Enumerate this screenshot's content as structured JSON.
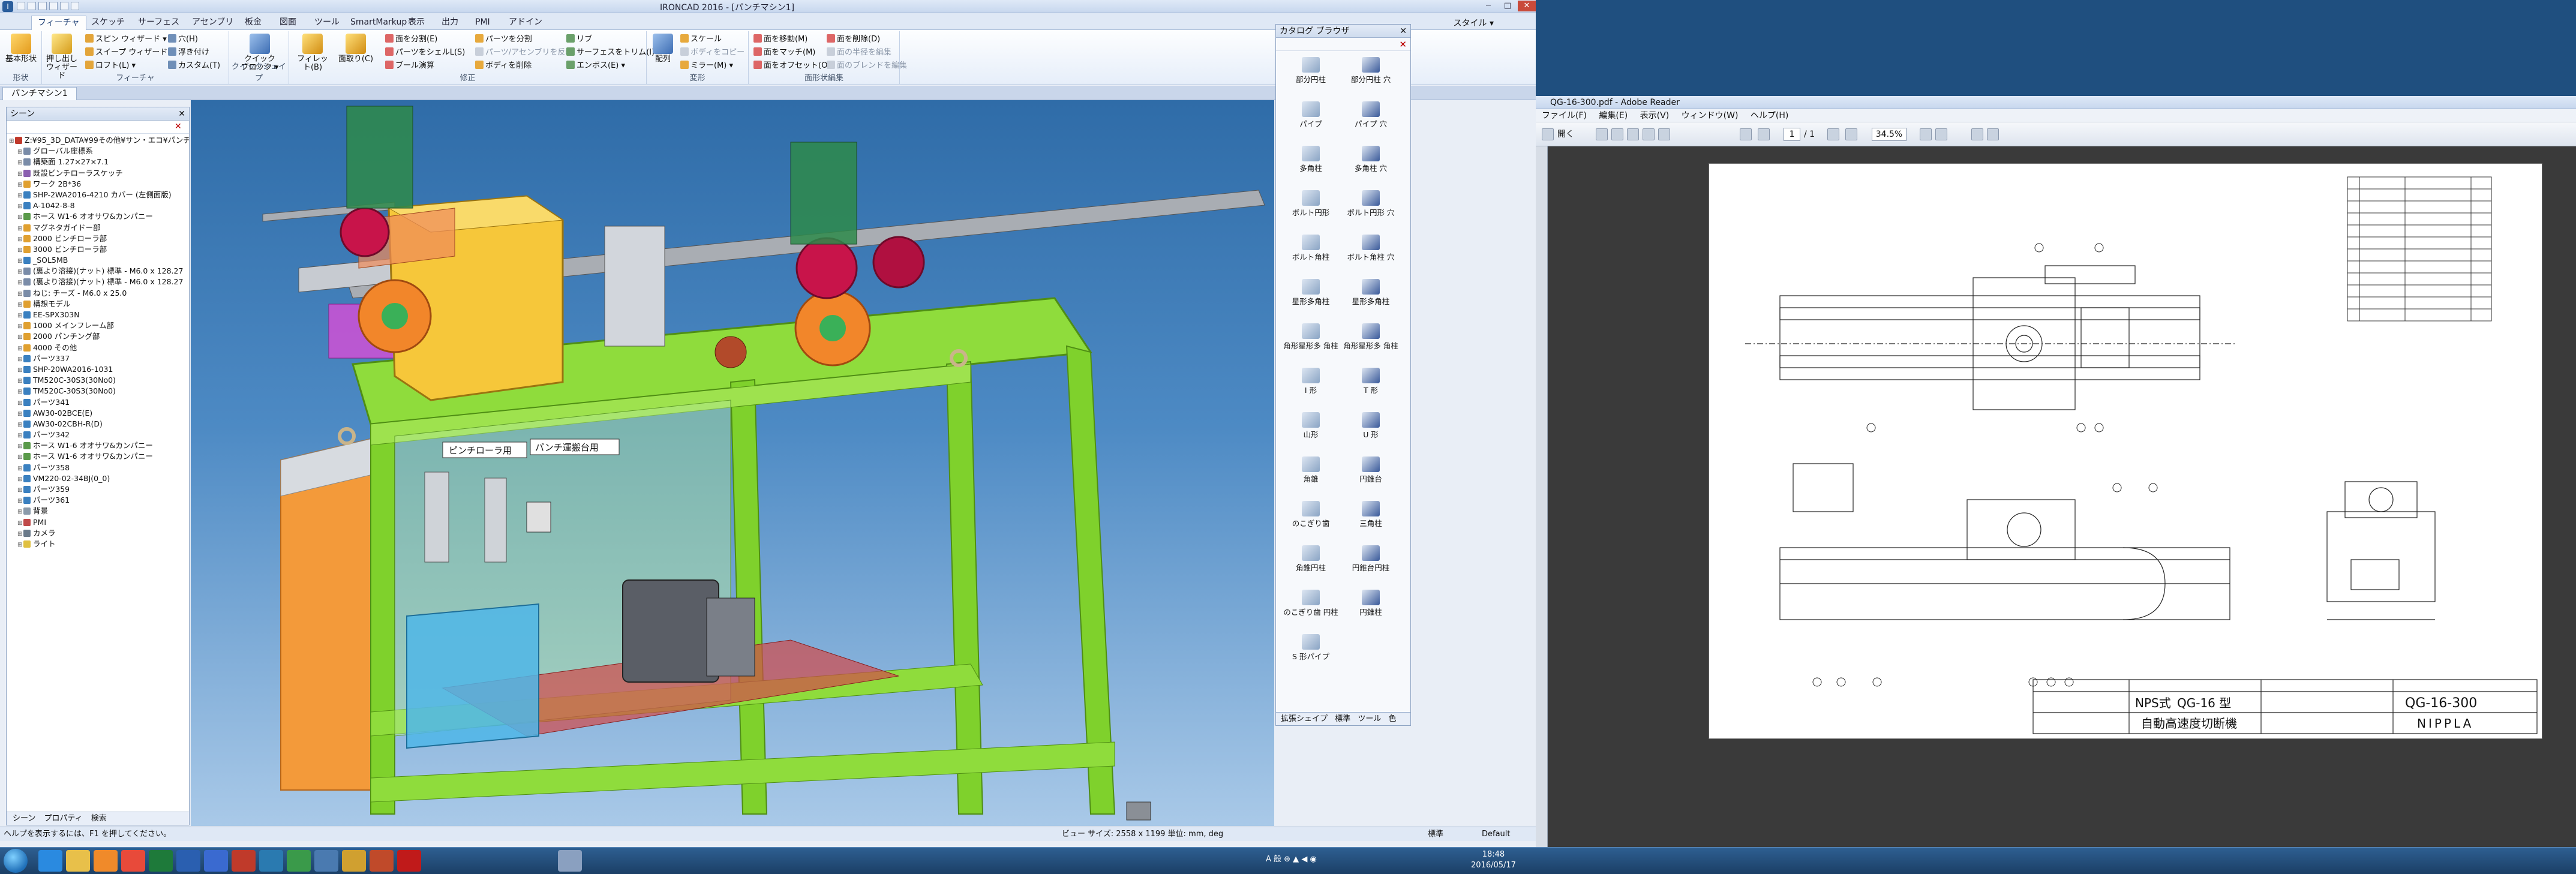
{
  "cad": {
    "title": "IRONCAD 2016 - [パンチマシン1]",
    "ribbon_tabs": [
      "フィーチャ",
      "スケッチ",
      "サーフェス",
      "アセンブリ",
      "板金",
      "図面",
      "ツール",
      "SmartMarkup",
      "表示",
      "出力",
      "PMI",
      "アドイン"
    ],
    "style_label": "スタイル ▾",
    "groups": {
      "basic": "形状",
      "feature": "フィーチャ",
      "quickshape": "クイックシェイプ",
      "modify": "修正",
      "transform": "変形",
      "faceedit": "面形状編集"
    },
    "buttons": {
      "basic_form": "基本形状",
      "push_pull": "押し出し ウィザード",
      "spin_wizard": "スピン ウィザード ▾",
      "sweep_wizard": "スイープ ウィザード ▾",
      "loft": "ロフト(L) ▾",
      "hole": "穴(H)",
      "emboss": "浮き付け",
      "custom": "カスタム(T)",
      "quick_block": "クイック ブロック ▾",
      "fillet": "フィレット(B)",
      "chamfer": "面取り(C)",
      "face_move": "面を分割(E)",
      "shell": "パーツをシェルL(S)",
      "draft": "ブール演算",
      "part_split": "パーツを分割",
      "part_assembly": "パーツ/アセンブリを反転",
      "body_delete": "ボディを削除",
      "rib": "リブ",
      "surface_trim": "サーフェスをトリム(I)",
      "emboss2": "エンボス(E) ▾",
      "scale": "スケール",
      "body_copy": "ボディをコピー",
      "mirror": "ミラー(M) ▾",
      "array": "配列",
      "face_move2": "面を移動(M)",
      "face_match": "面をマッチ(M)",
      "face_offset": "面をオフセット(O)",
      "face_delete": "面を削除(D)",
      "face_replace": "面の半径を編集",
      "face_blend": "面のブレンドを編集",
      "face_delete2": "面を削除(D)"
    },
    "doc_tab": "パンチマシン1",
    "scene_title": "シーン",
    "tree": [
      "Z:¥95_3D_DATA¥99その他¥サン・エコ¥パンチ",
      "グローバル座標系",
      "構築面  1.27×27×7.1",
      "既設ビンチローラスケッチ",
      "ワーク  2B*36",
      "SHP-2WA2016-4210  カバー (左側面版)",
      "A-1042-8-8",
      "ホース  W1-6    オオサワ&カンパニー",
      "マグネタガイドー部",
      "2000  ビンチローラ部",
      "3000  ビンチローラ部",
      "_SOL5MB",
      "(裏より溶接)(ナット) 標準 - M6.0 x 128.27",
      "(裏より溶接)(ナット) 標準 - M6.0 x 128.27",
      "ねじ: チーズ - M6.0 x 25.0",
      "構想モデル",
      "EE-SPX303N",
      "1000  メインフレーム部",
      "2000  パンチング部",
      "4000  その他",
      "パーツ337",
      "SHP-20WA2016-1031",
      "TM520C-30S3(30No0)",
      "TM520C-30S3(30No0)",
      "パーツ341",
      "AW30-02BCE(E)",
      "AW30-02CBH-R(D)",
      "パーツ342",
      "ホース  W1-6    オオサワ&カンパニー",
      "ホース  W1-6    オオサワ&カンパニー",
      "パーツ358",
      "VM220-02-34BJ(0_0)",
      "パーツ359",
      "パーツ361",
      "背景",
      "PMI",
      "カメラ",
      "ライト"
    ],
    "scene_tabs": [
      "シーン",
      "プロパティ",
      "検索"
    ],
    "viewport_labels": {
      "pinch": "ピンチローラ用",
      "punch": "パンチ運搬台用"
    },
    "catalog_title": "カタログ ブラウザ",
    "catalog_items": [
      "部分円柱",
      "部分円柱 穴",
      "パイプ",
      "パイプ 穴",
      "多角柱",
      "多角柱 穴",
      "ボルト円形",
      "ボルト円形 穴",
      "ボルト角柱",
      "ボルト角柱 穴",
      "星形多角柱",
      "星形多角柱",
      "角形星形多 角柱",
      "角形星形多 角柱",
      "I 形",
      "T 形",
      "山形",
      "U 形",
      "角錐",
      "円錐台",
      "のこぎり歯",
      "三角柱",
      "角錐円柱",
      "円錐台円柱",
      "のこぎり歯 円柱",
      "円錐柱",
      "S 形パイプ"
    ],
    "catalog_tabs": [
      "拡張シェイプ",
      "標準",
      "ツール",
      "色"
    ],
    "status_help": "ヘルプを表示するには、F1 を押してください。",
    "status_view": "ビュー サイズ: 2558 x 1199   単位: mm, deg",
    "status_mode": "標準",
    "status_default": "Default"
  },
  "pdf": {
    "title": "QG-16-300.pdf - Adobe Reader",
    "menu": [
      "ファイル(F)",
      "編集(E)",
      "表示(V)",
      "ウィンドウ(W)",
      "ヘルプ(H)"
    ],
    "open_label": "開く",
    "page_current": "1",
    "page_total": "/ 1",
    "zoom": "34.5%",
    "title_block": {
      "series": "NPS式",
      "model": "QG-16 型",
      "product": "自動高速度切断機",
      "drawing_no": "QG-16-300",
      "company": "NIPPLA"
    }
  },
  "taskbar": {
    "tray": "A 般 ⊕ ▲ ◀ ◉",
    "time": "18:48",
    "date": "2016/05/17"
  }
}
